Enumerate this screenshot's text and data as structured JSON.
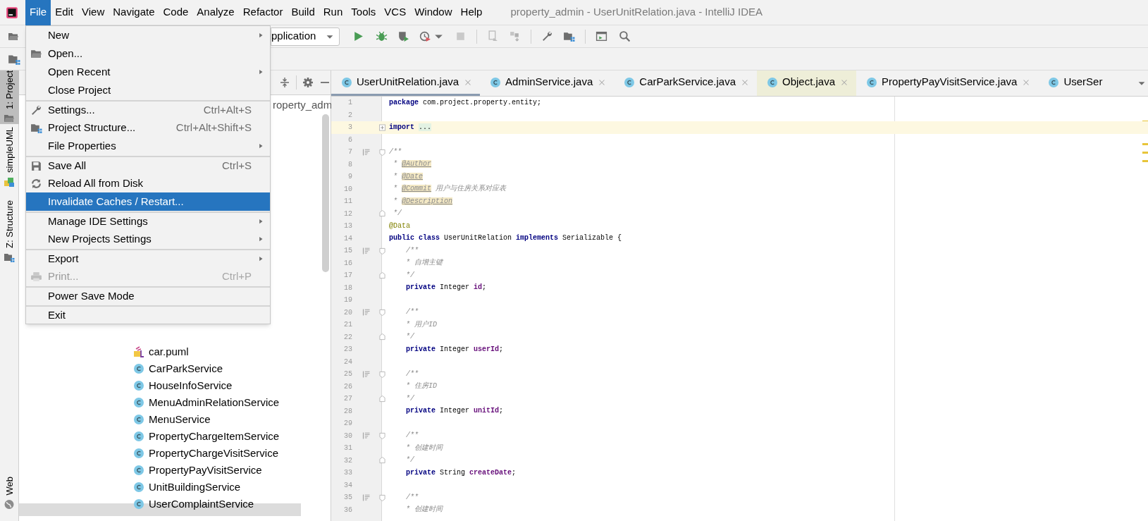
{
  "window": {
    "title": "property_admin - UserUnitRelation.java - IntelliJ IDEA"
  },
  "menu_bar": [
    {
      "label": "File",
      "selected": true
    },
    {
      "label": "Edit",
      "selected": false
    },
    {
      "label": "View",
      "selected": false
    },
    {
      "label": "Navigate",
      "selected": false
    },
    {
      "label": "Code",
      "selected": false
    },
    {
      "label": "Analyze",
      "selected": false
    },
    {
      "label": "Refactor",
      "selected": false
    },
    {
      "label": "Build",
      "selected": false
    },
    {
      "label": "Run",
      "selected": false
    },
    {
      "label": "Tools",
      "selected": false
    },
    {
      "label": "VCS",
      "selected": false
    },
    {
      "label": "Window",
      "selected": false
    },
    {
      "label": "Help",
      "selected": false
    }
  ],
  "toolbar": {
    "run_config": "pplication"
  },
  "file_menu": [
    {
      "label": "New",
      "submenu": true,
      "selected": false,
      "disabled": false,
      "separator_before": false
    },
    {
      "label": "Open...",
      "submenu": false,
      "selected": false,
      "disabled": false,
      "separator_before": false
    },
    {
      "label": "Open Recent",
      "submenu": true,
      "selected": false,
      "disabled": false,
      "separator_before": false
    },
    {
      "label": "Close Project",
      "submenu": false,
      "selected": false,
      "disabled": false,
      "separator_before": false
    },
    {
      "label": "Settings...",
      "shortcut": "Ctrl+Alt+S",
      "submenu": false,
      "selected": false,
      "disabled": false,
      "separator_before": true
    },
    {
      "label": "Project Structure...",
      "shortcut": "Ctrl+Alt+Shift+S",
      "submenu": false,
      "selected": false,
      "disabled": false,
      "separator_before": false
    },
    {
      "label": "File Properties",
      "submenu": true,
      "selected": false,
      "disabled": false,
      "separator_before": false
    },
    {
      "label": "Save All",
      "shortcut": "Ctrl+S",
      "submenu": false,
      "selected": false,
      "disabled": false,
      "separator_before": true
    },
    {
      "label": "Reload All from Disk",
      "submenu": false,
      "selected": false,
      "disabled": false,
      "separator_before": false
    },
    {
      "label": "Invalidate Caches / Restart...",
      "submenu": false,
      "selected": true,
      "disabled": false,
      "separator_before": false
    },
    {
      "label": "Manage IDE Settings",
      "submenu": true,
      "selected": false,
      "disabled": false,
      "separator_before": true
    },
    {
      "label": "New Projects Settings",
      "submenu": true,
      "selected": false,
      "disabled": false,
      "separator_before": false
    },
    {
      "label": "Export",
      "submenu": true,
      "selected": false,
      "disabled": false,
      "separator_before": true
    },
    {
      "label": "Print...",
      "shortcut": "Ctrl+P",
      "submenu": false,
      "selected": false,
      "disabled": true,
      "separator_before": false
    },
    {
      "label": "Power Save Mode",
      "submenu": false,
      "selected": false,
      "disabled": false,
      "separator_before": true
    },
    {
      "label": "Exit",
      "submenu": false,
      "selected": false,
      "disabled": false,
      "separator_before": true
    }
  ],
  "tool_strip": [
    {
      "label": "1: Project",
      "selected": true
    },
    {
      "label": "simpleUML",
      "selected": false
    },
    {
      "label": "Z: Structure",
      "selected": false
    },
    {
      "label": "Web",
      "selected": false
    }
  ],
  "project_tree": {
    "root": "roperty_adm",
    "items": [
      {
        "kind": "puml",
        "label": "car.puml"
      },
      {
        "kind": "class",
        "label": "CarParkService"
      },
      {
        "kind": "class",
        "label": "HouseInfoService"
      },
      {
        "kind": "class",
        "label": "MenuAdminRelationService"
      },
      {
        "kind": "class",
        "label": "MenuService"
      },
      {
        "kind": "class",
        "label": "PropertyChargeItemService"
      },
      {
        "kind": "class",
        "label": "PropertyChargeVisitService"
      },
      {
        "kind": "class",
        "label": "PropertyPayVisitService"
      },
      {
        "kind": "class",
        "label": "UnitBuildingService"
      },
      {
        "kind": "class",
        "label": "UserComplaintService"
      }
    ]
  },
  "editor": {
    "tabs": [
      {
        "label": "UserUnitRelation.java",
        "kind": "project",
        "selected": true,
        "closable": true
      },
      {
        "label": "AdminService.java",
        "kind": "project",
        "selected": false,
        "closable": true
      },
      {
        "label": "CarParkService.java",
        "kind": "project",
        "selected": false,
        "closable": true
      },
      {
        "label": "Object.java",
        "kind": "library",
        "selected": false,
        "closable": true
      },
      {
        "label": "PropertyPayVisitService.java",
        "kind": "project",
        "selected": false,
        "closable": true
      },
      {
        "label": "UserSer",
        "kind": "project",
        "selected": false,
        "closable": false
      }
    ],
    "lines": [
      {
        "number": "1",
        "kind": "code",
        "current": false,
        "tokens": [
          {
            "kind": "keyword",
            "text": "package"
          },
          {
            "kind": "plain",
            "text": " com.project.property.entity;"
          }
        ]
      },
      {
        "number": "2",
        "kind": "code",
        "current": false
      },
      {
        "number": "3",
        "kind": "folded",
        "current": true,
        "tokens": [
          {
            "kind": "keyword",
            "text": "import"
          },
          {
            "kind": "folded",
            "text": "..."
          }
        ]
      },
      {
        "number": "6",
        "kind": "code",
        "current": false
      },
      {
        "number": "7",
        "kind": "doc_start",
        "current": false,
        "tokens": [
          {
            "kind": "comment",
            "text": "/**"
          }
        ]
      },
      {
        "number": "8",
        "kind": "code",
        "current": false,
        "tokens": [
          {
            "kind": "comment",
            "text": " * "
          },
          {
            "kind": "doc_tag",
            "text": "@Author"
          }
        ]
      },
      {
        "number": "9",
        "kind": "code",
        "current": false,
        "tokens": [
          {
            "kind": "comment",
            "text": " * "
          },
          {
            "kind": "doc_tag",
            "text": "@Date"
          }
        ]
      },
      {
        "number": "10",
        "kind": "code",
        "current": false,
        "tokens": [
          {
            "kind": "comment",
            "text": " * "
          },
          {
            "kind": "doc_tag",
            "text": "@Commit"
          },
          {
            "kind": "comment",
            "text": " 用户与住房关系对应表"
          }
        ]
      },
      {
        "number": "11",
        "kind": "code",
        "current": false,
        "tokens": [
          {
            "kind": "comment",
            "text": " * "
          },
          {
            "kind": "doc_tag",
            "text": "@Description"
          }
        ]
      },
      {
        "number": "12",
        "kind": "doc_end",
        "current": false,
        "tokens": [
          {
            "kind": "comment",
            "text": " */"
          }
        ]
      },
      {
        "number": "13",
        "kind": "code",
        "current": false,
        "tokens": [
          {
            "kind": "annotation",
            "text": "@Data"
          }
        ]
      },
      {
        "number": "14",
        "kind": "code",
        "current": false,
        "tokens": [
          {
            "kind": "keyword",
            "text": "public class"
          },
          {
            "kind": "plain",
            "text": " UserUnitRelation "
          },
          {
            "kind": "keyword",
            "text": "implements"
          },
          {
            "kind": "plain",
            "text": " Serializable {"
          }
        ]
      },
      {
        "number": "15",
        "kind": "doc_start",
        "current": false,
        "tokens": [
          {
            "kind": "comment",
            "text": "    /**"
          }
        ]
      },
      {
        "number": "16",
        "kind": "code",
        "current": false,
        "tokens": [
          {
            "kind": "comment",
            "text": "    * 自增主键"
          }
        ]
      },
      {
        "number": "17",
        "kind": "doc_end",
        "current": false,
        "tokens": [
          {
            "kind": "comment",
            "text": "    */"
          }
        ]
      },
      {
        "number": "18",
        "kind": "code",
        "current": false,
        "tokens": [
          {
            "kind": "keyword",
            "text": "    private"
          },
          {
            "kind": "plain",
            "text": " Integer "
          },
          {
            "kind": "field",
            "text": "id"
          },
          {
            "kind": "plain",
            "text": ";"
          }
        ]
      },
      {
        "number": "19",
        "kind": "code",
        "current": false
      },
      {
        "number": "20",
        "kind": "doc_start",
        "current": false,
        "tokens": [
          {
            "kind": "comment",
            "text": "    /**"
          }
        ]
      },
      {
        "number": "21",
        "kind": "code",
        "current": false,
        "tokens": [
          {
            "kind": "comment",
            "text": "    * 用户ID"
          }
        ]
      },
      {
        "number": "22",
        "kind": "doc_end",
        "current": false,
        "tokens": [
          {
            "kind": "comment",
            "text": "    */"
          }
        ]
      },
      {
        "number": "23",
        "kind": "code",
        "current": false,
        "tokens": [
          {
            "kind": "keyword",
            "text": "    private"
          },
          {
            "kind": "plain",
            "text": " Integer "
          },
          {
            "kind": "field",
            "text": "userId"
          },
          {
            "kind": "plain",
            "text": ";"
          }
        ]
      },
      {
        "number": "24",
        "kind": "code",
        "current": false
      },
      {
        "number": "25",
        "kind": "doc_start",
        "current": false,
        "tokens": [
          {
            "kind": "comment",
            "text": "    /**"
          }
        ]
      },
      {
        "number": "26",
        "kind": "code",
        "current": false,
        "tokens": [
          {
            "kind": "comment",
            "text": "    * 住房ID"
          }
        ]
      },
      {
        "number": "27",
        "kind": "doc_end",
        "current": false,
        "tokens": [
          {
            "kind": "comment",
            "text": "    */"
          }
        ]
      },
      {
        "number": "28",
        "kind": "code",
        "current": false,
        "tokens": [
          {
            "kind": "keyword",
            "text": "    private"
          },
          {
            "kind": "plain",
            "text": " Integer "
          },
          {
            "kind": "field",
            "text": "unitId"
          },
          {
            "kind": "plain",
            "text": ";"
          }
        ]
      },
      {
        "number": "29",
        "kind": "code",
        "current": false
      },
      {
        "number": "30",
        "kind": "doc_start",
        "current": false,
        "tokens": [
          {
            "kind": "comment",
            "text": "    /**"
          }
        ]
      },
      {
        "number": "31",
        "kind": "code",
        "current": false,
        "tokens": [
          {
            "kind": "comment",
            "text": "    * 创建时间"
          }
        ]
      },
      {
        "number": "32",
        "kind": "doc_end",
        "current": false,
        "tokens": [
          {
            "kind": "comment",
            "text": "    */"
          }
        ]
      },
      {
        "number": "33",
        "kind": "code",
        "current": false,
        "tokens": [
          {
            "kind": "keyword",
            "text": "    private"
          },
          {
            "kind": "plain",
            "text": " String "
          },
          {
            "kind": "field",
            "text": "createDate"
          },
          {
            "kind": "plain",
            "text": ";"
          }
        ]
      },
      {
        "number": "34",
        "kind": "code",
        "current": false
      },
      {
        "number": "35",
        "kind": "doc_start",
        "current": false,
        "tokens": [
          {
            "kind": "comment",
            "text": "    /**"
          }
        ]
      },
      {
        "number": "36",
        "kind": "code",
        "current": false,
        "tokens": [
          {
            "kind": "comment",
            "text": "    * 创建时间"
          }
        ]
      }
    ]
  }
}
